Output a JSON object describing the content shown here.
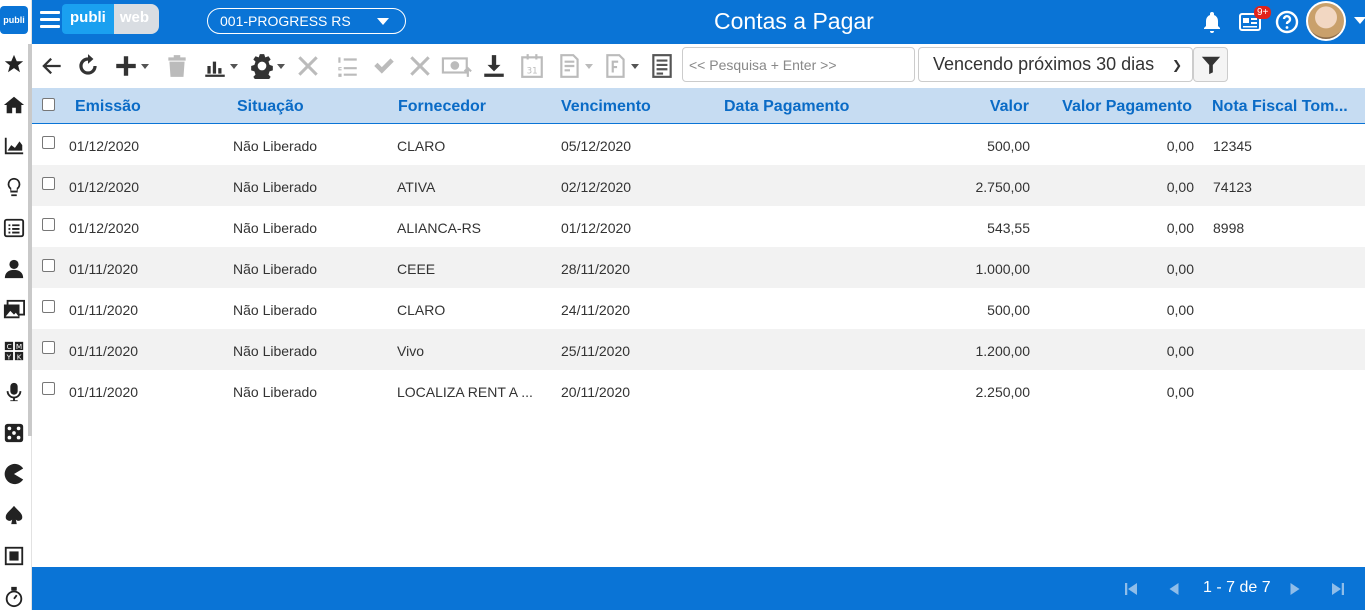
{
  "app": {
    "brand_left": "publi",
    "brand_right": "web",
    "side_logo": "publi"
  },
  "header": {
    "company": "001-PROGRESS RS",
    "title": "Contas a Pagar",
    "badge": "9+"
  },
  "sidebar": {
    "icons": [
      "star-icon",
      "home-icon",
      "area-chart-icon",
      "lightbulb-icon",
      "list-icon",
      "users-icon",
      "images-icon",
      "cmyk-icon",
      "microphone-icon",
      "dice-icon",
      "pacman-icon",
      "spade-icon",
      "square-icon",
      "stopwatch-icon"
    ]
  },
  "toolbar": {
    "search_placeholder": "<< Pesquisa + Enter >>",
    "filter_value": "Vencendo próximos 30 dias"
  },
  "table": {
    "headers": {
      "emissao": "Emissão",
      "situacao": "Situação",
      "fornecedor": "Fornecedor",
      "vencimento": "Vencimento",
      "data_pagamento": "Data Pagamento",
      "valor": "Valor",
      "valor_pagamento": "Valor Pagamento",
      "nota_fiscal": "Nota Fiscal Tom..."
    },
    "rows": [
      {
        "emissao": "01/12/2020",
        "situacao": "Não Liberado",
        "fornecedor": "CLARO",
        "vencimento": "05/12/2020",
        "data_pagamento": "",
        "valor": "500,00",
        "valor_pagamento": "0,00",
        "nota_fiscal": "12345"
      },
      {
        "emissao": "01/12/2020",
        "situacao": "Não Liberado",
        "fornecedor": "ATIVA",
        "vencimento": "02/12/2020",
        "data_pagamento": "",
        "valor": "2.750,00",
        "valor_pagamento": "0,00",
        "nota_fiscal": "74123"
      },
      {
        "emissao": "01/12/2020",
        "situacao": "Não Liberado",
        "fornecedor": "ALIANCA-RS",
        "vencimento": "01/12/2020",
        "data_pagamento": "",
        "valor": "543,55",
        "valor_pagamento": "0,00",
        "nota_fiscal": "8998"
      },
      {
        "emissao": "01/11/2020",
        "situacao": "Não Liberado",
        "fornecedor": "CEEE",
        "vencimento": "28/11/2020",
        "data_pagamento": "",
        "valor": "1.000,00",
        "valor_pagamento": "0,00",
        "nota_fiscal": ""
      },
      {
        "emissao": "01/11/2020",
        "situacao": "Não Liberado",
        "fornecedor": "CLARO",
        "vencimento": "24/11/2020",
        "data_pagamento": "",
        "valor": "500,00",
        "valor_pagamento": "0,00",
        "nota_fiscal": ""
      },
      {
        "emissao": "01/11/2020",
        "situacao": "Não Liberado",
        "fornecedor": "Vivo",
        "vencimento": "25/11/2020",
        "data_pagamento": "",
        "valor": "1.200,00",
        "valor_pagamento": "0,00",
        "nota_fiscal": ""
      },
      {
        "emissao": "01/11/2020",
        "situacao": "Não Liberado",
        "fornecedor": "LOCALIZA RENT A ...",
        "vencimento": "20/11/2020",
        "data_pagamento": "",
        "valor": "2.250,00",
        "valor_pagamento": "0,00",
        "nota_fiscal": ""
      }
    ]
  },
  "footer": {
    "pager_text": "1 - 7 de 7"
  },
  "colors": {
    "primary": "#0a74d6",
    "header_bg": "#c6dcf2",
    "alt_row": "#f2f2f2"
  }
}
